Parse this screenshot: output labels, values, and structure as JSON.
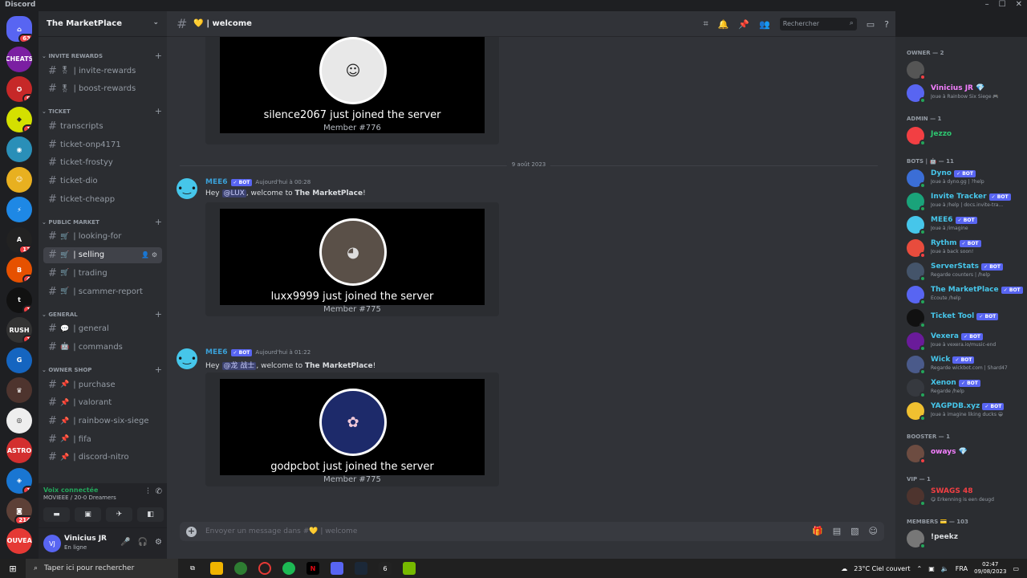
{
  "app": {
    "title": "Discord"
  },
  "window_controls": [
    "–",
    "☐",
    "✕"
  ],
  "servers": [
    {
      "label": "⌂",
      "color": "#5865f2",
      "badge": "63"
    },
    {
      "label": "CHEATS",
      "color": "#7b1fa2",
      "badge": ""
    },
    {
      "label": "✪",
      "color": "#c62828",
      "badge": "9"
    },
    {
      "label": "◆",
      "color": "#d4e000",
      "badge": "1"
    },
    {
      "label": "◉",
      "color": "#2a8fb8",
      "badge": ""
    },
    {
      "label": "☺",
      "color": "#e8b020",
      "badge": ""
    },
    {
      "label": "⚡",
      "color": "#1e88e5",
      "badge": ""
    },
    {
      "label": "A",
      "color": "#222222",
      "badge": "13"
    },
    {
      "label": "B",
      "color": "#e65100",
      "badge": "4"
    },
    {
      "label": "t",
      "color": "#111111",
      "badge": "1"
    },
    {
      "label": "RUSH",
      "color": "#333333",
      "badge": "1"
    },
    {
      "label": "G",
      "color": "#1565c0",
      "badge": ""
    },
    {
      "label": "♛",
      "color": "#4e342e",
      "badge": ""
    },
    {
      "label": "◎",
      "color": "#eeeeee",
      "badge": ""
    },
    {
      "label": "ASTRO",
      "color": "#d32f2f",
      "badge": ""
    },
    {
      "label": "◈",
      "color": "#1976d2",
      "badge": "1"
    },
    {
      "label": "◙",
      "color": "#5d4037",
      "badge": "214"
    },
    {
      "label": "NOUVEAU",
      "color": "#e53935",
      "badge": ""
    }
  ],
  "server_name": "The MarketPlace",
  "categories": [
    {
      "name": "INVITE REWARDS",
      "channels": [
        {
          "emoji": "🎖",
          "name": "| invite-rewards"
        },
        {
          "emoji": "🎖",
          "name": "| boost-rewards"
        }
      ]
    },
    {
      "name": "TICKET",
      "channels": [
        {
          "emoji": "",
          "name": "transcripts"
        },
        {
          "emoji": "",
          "name": "ticket-onp4171"
        },
        {
          "emoji": "",
          "name": "ticket-frostyy"
        },
        {
          "emoji": "",
          "name": "ticket-dio"
        },
        {
          "emoji": "",
          "name": "ticket-cheapp"
        }
      ]
    },
    {
      "name": "PUBLIC MARKET",
      "channels": [
        {
          "emoji": "🛒",
          "name": "| looking-for"
        },
        {
          "emoji": "🛒",
          "name": "| selling"
        },
        {
          "emoji": "🛒",
          "name": "| trading"
        },
        {
          "emoji": "🛒",
          "name": "| scammer-report"
        }
      ]
    },
    {
      "name": "GENERAL",
      "channels": [
        {
          "emoji": "💬",
          "name": "| general"
        },
        {
          "emoji": "🤖",
          "name": "| commands"
        }
      ]
    },
    {
      "name": "OWNER SHOP",
      "channels": [
        {
          "emoji": "📌",
          "name": "| purchase"
        },
        {
          "emoji": "📌",
          "name": "| valorant"
        },
        {
          "emoji": "📌",
          "name": "| rainbow-six-siege"
        },
        {
          "emoji": "📌",
          "name": "| fifa"
        },
        {
          "emoji": "📌",
          "name": "| discord-nitro"
        }
      ]
    }
  ],
  "voice": {
    "status": "Voix connectée",
    "location": "MOVIEEE / 20-0 Dreamers"
  },
  "user": {
    "name": "Vinicius JR",
    "status": "En ligne",
    "initials": "VJ"
  },
  "channel_header": {
    "name": "💛 | welcome",
    "search_placeholder": "Rechercher"
  },
  "messages": [
    {
      "join_text": "silence2067 just joined the server",
      "member": "Member #776"
    },
    {
      "date_divider": "9 août 2023"
    },
    {
      "author": "MEE6",
      "bot": "✓ BOT",
      "time": "Aujourd'hui à 00:28",
      "pre": "Hey ",
      "mention": "@LUX",
      "post": ", welcome to ",
      "server": "The MarketPlace",
      "end": "!",
      "join_text": "luxx9999 just joined the server",
      "member": "Member #775"
    },
    {
      "author": "MEE6",
      "bot": "✓ BOT",
      "time": "Aujourd'hui à 01:22",
      "pre": "Hey ",
      "mention": "@龙 战士",
      "post": ", welcome to ",
      "server": "The MarketPlace",
      "end": "!",
      "join_text": "godpcbot just joined the server",
      "member": "Member #775"
    }
  ],
  "composer": {
    "placeholder": "Envoyer un message dans #💛 | welcome"
  },
  "member_groups": [
    {
      "title": "OWNER — 2",
      "members": [
        {
          "name": "",
          "sub": "",
          "color": "#f23f43",
          "av": "#555555",
          "status": "#f23f43"
        },
        {
          "name": "Vinicius JR 💎",
          "sub": "Joue à Rainbow Six Siege 🎮",
          "color": "#f47fff",
          "av": "#5865f2",
          "status": "#23a55a"
        }
      ]
    },
    {
      "title": "ADMIN — 1",
      "members": [
        {
          "name": "Jezzo",
          "sub": "",
          "color": "#2dc770",
          "av": "#f23f43",
          "status": "#23a55a"
        }
      ]
    },
    {
      "title": "BOTS | 🤖 — 11",
      "members": [
        {
          "name": "Dyno",
          "sub": "Joue à dyno.gg | ?help",
          "color": "#46c6ea",
          "av": "#3b6ed6",
          "status": "#23a55a"
        },
        {
          "name": "Invite Tracker",
          "sub": "Joue à /help | docs.invite-tra...",
          "color": "#46c6ea",
          "av": "#1aa37a",
          "status": "#23a55a"
        },
        {
          "name": "MEE6",
          "sub": "Joue à /imagine",
          "color": "#46c6ea",
          "av": "#46c6ea",
          "status": "#23a55a"
        },
        {
          "name": "Rythm",
          "sub": "Joue à back soon!",
          "color": "#46c6ea",
          "av": "#e84c3d",
          "status": "#f23f43"
        },
        {
          "name": "ServerStats",
          "sub": "Regarde counters | /help",
          "color": "#46c6ea",
          "av": "#44546a",
          "status": "#23a55a"
        },
        {
          "name": "The MarketPlace",
          "sub": "Écoute /help",
          "color": "#46c6ea",
          "av": "#5865f2",
          "status": "#23a55a"
        },
        {
          "name": "Ticket Tool",
          "sub": "",
          "color": "#46c6ea",
          "av": "#111111",
          "status": "#23a55a"
        },
        {
          "name": "Vexera",
          "sub": "Joue à vexera.io/music-end",
          "color": "#46c6ea",
          "av": "#6a1b9a",
          "status": "#23a55a"
        },
        {
          "name": "Wick",
          "sub": "Regarde wickbot.com | Shard47",
          "color": "#46c6ea",
          "av": "#4a5a8a",
          "status": "#23a55a"
        },
        {
          "name": "Xenon",
          "sub": "Regarde /help",
          "color": "#46c6ea",
          "av": "#36393f",
          "status": "#23a55a"
        },
        {
          "name": "YAGPDB.xyz",
          "sub": "Joue à imagine liking ducks 😀",
          "color": "#46c6ea",
          "av": "#f0c030",
          "status": "#23a55a"
        }
      ]
    },
    {
      "title": "BOOSTER — 1",
      "members": [
        {
          "name": "oways 💎",
          "sub": "",
          "color": "#f47fff",
          "av": "#6d4c41",
          "status": "#f23f43"
        }
      ]
    },
    {
      "title": "VIP — 1",
      "members": [
        {
          "name": "SWAGS 48",
          "sub": "😋 Erkenning is een deugd",
          "color": "#f23f43",
          "av": "#4e342e",
          "status": "#23a55a"
        }
      ]
    },
    {
      "title": "MEMBERS 💳 — 103",
      "members": [
        {
          "name": "!peekz",
          "sub": "",
          "color": "#dbdee1",
          "av": "#777777",
          "status": "#23a55a"
        }
      ]
    }
  ],
  "taskbar": {
    "search": "Taper ici pour rechercher",
    "weather": "23°C  Ciel couvert",
    "lang": "FRA",
    "time": "02:47",
    "date": "09/08/2023"
  }
}
